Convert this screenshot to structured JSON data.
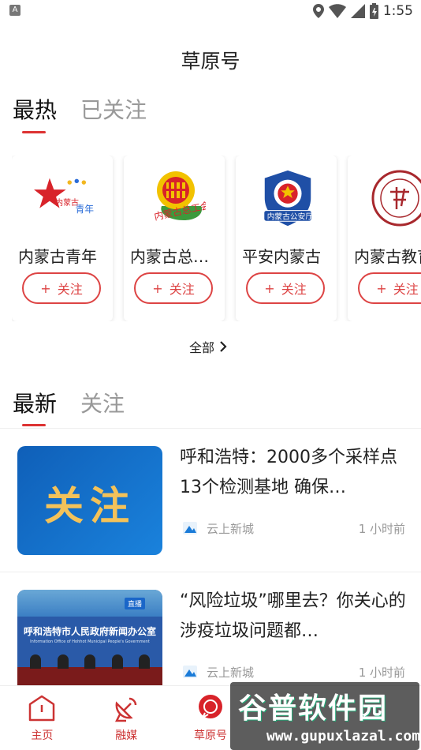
{
  "status_bar": {
    "time": "1:55",
    "left_badge": "A"
  },
  "page_title": "草原号",
  "tabs_top": [
    {
      "label": "最热",
      "active": true
    },
    {
      "label": "已关注",
      "active": false
    }
  ],
  "accounts": [
    {
      "name": "内蒙古青年",
      "follow_label": "关注",
      "logo": "youth-league-logo"
    },
    {
      "name": "内蒙古总工会",
      "follow_label": "关注",
      "logo": "trade-union-logo"
    },
    {
      "name": "平安内蒙古",
      "follow_label": "关注",
      "logo": "police-badge-logo"
    },
    {
      "name": "内蒙古教育",
      "follow_label": "关注",
      "logo": "education-seal-logo"
    }
  ],
  "all_link": "全部",
  "tabs_mid": [
    {
      "label": "最新",
      "active": true
    },
    {
      "label": "关注",
      "active": false
    }
  ],
  "news": [
    {
      "title": "呼和浩特：2000多个采样点 13个检测基地 确保…",
      "thumb_text": "关注",
      "source": "云上新城",
      "time": "1 小时前"
    },
    {
      "title": "“风险垃圾”哪里去？你关心的涉疫垃圾问题都…",
      "thumb_banner": "呼和浩特市人民政府新闻办公室",
      "thumb_banner_en": "Information Office of Hohhot Municipal People's Government",
      "thumb_badge": "直播",
      "source": "云上新城",
      "time": "1 小时前"
    }
  ],
  "bottom_nav": [
    {
      "label": "主页",
      "icon": "home-icon"
    },
    {
      "label": "融媒",
      "icon": "satellite-dish-icon"
    },
    {
      "label": "草原号",
      "icon": "chat-bubble-icon"
    }
  ],
  "watermark": {
    "main": "谷普软件园",
    "url": "www.gupuxlazal.com"
  },
  "colors": {
    "accent": "#d33333",
    "thumb_blue": "#1677d2",
    "thumb_text": "#f3c25a"
  }
}
